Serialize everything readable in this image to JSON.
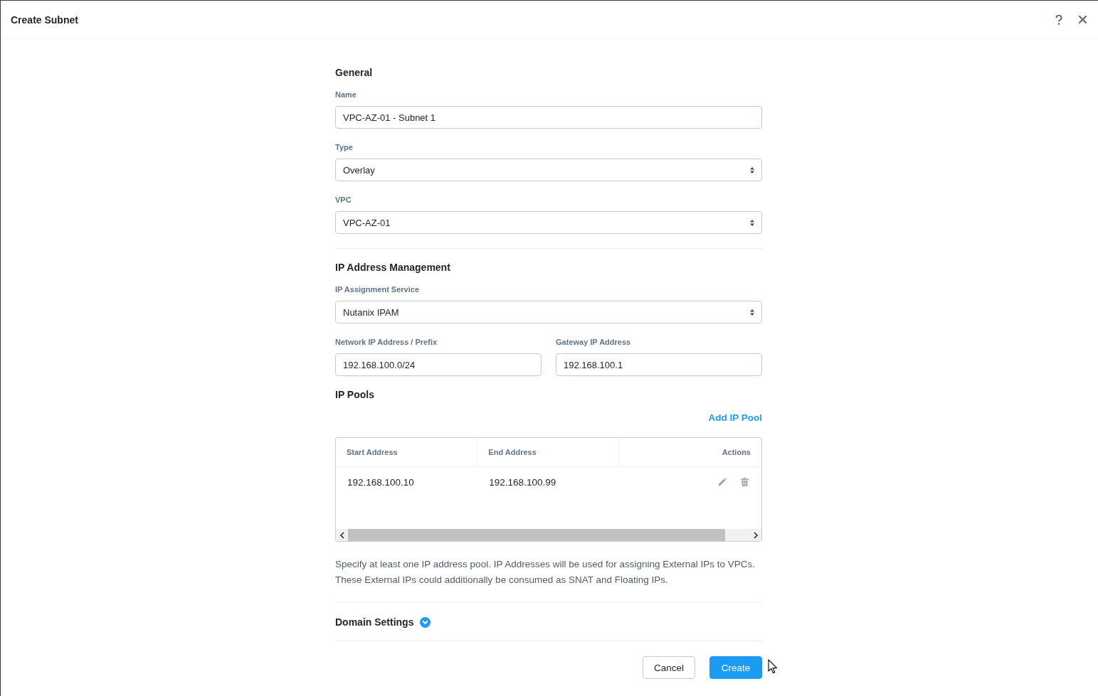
{
  "window": {
    "title": "Create Subnet"
  },
  "general": {
    "heading": "General",
    "fields": [
      {
        "kind": "text",
        "label": "Name",
        "value": "VPC-AZ-01 - Subnet 1"
      },
      {
        "kind": "select",
        "label": "Type",
        "value": "Overlay"
      },
      {
        "kind": "select",
        "label": "VPC",
        "value": "VPC-AZ-01"
      }
    ]
  },
  "ip_address_management": {
    "heading": "IP Address Management",
    "fields": [
      {
        "kind": "select",
        "label": "IP Assignment Service",
        "value": "Nutanix IPAM"
      }
    ],
    "address_fields": [
      {
        "kind": "text",
        "label": "Network IP Address / Prefix",
        "value": "192.168.100.0/24"
      },
      {
        "kind": "text",
        "label": "Gateway IP Address",
        "value": "192.168.100.1"
      }
    ]
  },
  "ip_pools": {
    "heading": "IP Pools",
    "add_link": "Add IP Pool",
    "table": {
      "columns": [
        "Start Address",
        "End Address",
        "Actions"
      ],
      "rows": [
        {
          "cells": [
            "192.168.100.10",
            "192.168.100.99"
          ]
        }
      ]
    },
    "description": "Specify at least one IP address pool. IP Addresses will be used for assigning External IPs to VPCs. These External IPs could additionally be consumed as SNAT and Floating IPs."
  },
  "domain_settings": {
    "heading": "Domain Settings",
    "expanded": false
  },
  "buttons": [
    {
      "kind": "secondary",
      "label": "Cancel"
    },
    {
      "kind": "primary",
      "label": "Create"
    }
  ]
}
